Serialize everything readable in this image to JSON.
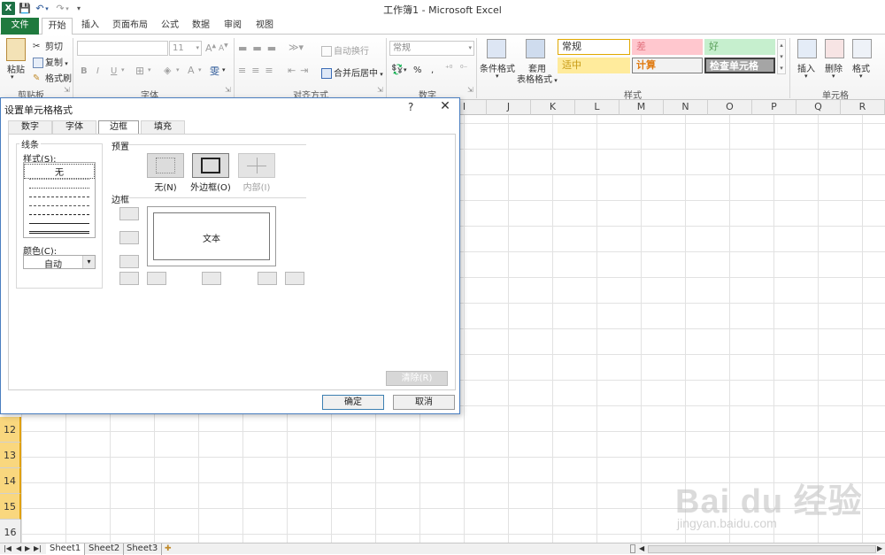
{
  "window": {
    "title": "工作簿1 - Microsoft Excel",
    "logo_letter": "X"
  },
  "ribbon_tabs": [
    "文件",
    "开始",
    "插入",
    "页面布局",
    "公式",
    "数据",
    "审阅",
    "视图"
  ],
  "ribbon": {
    "clipboard": {
      "label": "剪贴板",
      "paste": "粘贴",
      "cut": "剪切",
      "copy": "复制",
      "format_painter": "格式刷"
    },
    "font": {
      "label": "字体",
      "font_size": "11",
      "bold": "B",
      "italic": "I",
      "underline": "U"
    },
    "alignment": {
      "label": "对齐方式",
      "wrap_text": "自动换行",
      "merge_center": "合并后居中"
    },
    "number": {
      "label": "数字",
      "format": "常规",
      "percent": "%",
      "comma": ","
    },
    "styles": {
      "label": "样式",
      "conditional_format": "条件格式",
      "table_format_line1": "套用",
      "table_format_line2": "表格格式",
      "cells": [
        {
          "text": "常规",
          "bg": "#ffffff",
          "color": "#333333",
          "border": "#e0a800"
        },
        {
          "text": "差",
          "bg": "#ffc7ce",
          "color": "#e2737f",
          "border": "#ffc7ce"
        },
        {
          "text": "好",
          "bg": "#c6efce",
          "color": "#5a9f5a",
          "border": "#c6efce"
        },
        {
          "text": "适中",
          "bg": "#ffeb9c",
          "color": "#c79a14",
          "border": "#ffeb9c"
        },
        {
          "text": "计算",
          "bg": "#f2f2f2",
          "color": "#e07a10",
          "border": "#7f7f7f"
        },
        {
          "text": "检查单元格",
          "bg": "#a5a5a5",
          "color": "#ffffff",
          "border": "#3f3f3f"
        }
      ]
    },
    "cells_group": {
      "label": "单元格",
      "insert": "插入",
      "delete": "删除",
      "format": "格式"
    }
  },
  "sheet": {
    "columns": [
      "I",
      "J",
      "K",
      "L",
      "M",
      "N",
      "O",
      "P",
      "Q",
      "R"
    ],
    "rows": [
      "12",
      "13",
      "14",
      "15",
      "16"
    ],
    "selected_rows": [
      "12",
      "13",
      "14",
      "15"
    ]
  },
  "sheet_tabs": [
    "Sheet1",
    "Sheet2",
    "Sheet3"
  ],
  "watermark": {
    "main": "Bai du 经验",
    "sub": "jingyan.baidu.com"
  },
  "dialog": {
    "title": "设置单元格格式",
    "help": "?",
    "close": "✕",
    "tabs": [
      "数字",
      "字体",
      "边框",
      "填充"
    ],
    "active_tab": "边框",
    "line_group": {
      "legend": "线条",
      "style_label": "样式(S):",
      "none_label": "无",
      "color_label": "颜色(C):",
      "color_value": "自动"
    },
    "presets": {
      "legend": "预置",
      "none": "无(N)",
      "outline": "外边框(O)",
      "inside": "内部(I)"
    },
    "border": {
      "legend": "边框",
      "preview_text": "文本"
    },
    "buttons": {
      "clear": "清除(R)",
      "ok": "确定",
      "cancel": "取消"
    }
  }
}
